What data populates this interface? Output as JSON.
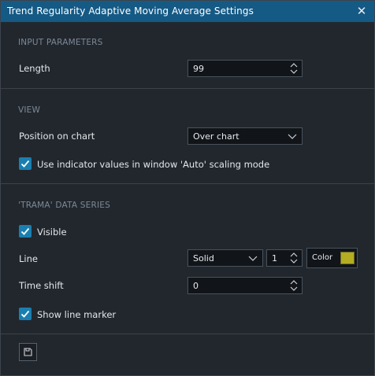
{
  "window": {
    "title": "Trend Regularity Adaptive Moving Average Settings"
  },
  "sections": {
    "input": {
      "title": "INPUT PARAMETERS",
      "length_label": "Length",
      "length_value": "99"
    },
    "view": {
      "title": "VIEW",
      "position_label": "Position on chart",
      "position_value": "Over chart",
      "auto_scaling_label": "Use indicator values in window 'Auto' scaling mode",
      "auto_scaling_checked": true
    },
    "series": {
      "title": "'TRAMA' DATA SERIES",
      "visible_label": "Visible",
      "visible_checked": true,
      "line_label": "Line",
      "line_style": "Solid",
      "line_width": "1",
      "color_label": "Color",
      "line_color": "#b4ac21",
      "time_shift_label": "Time shift",
      "time_shift_value": "0",
      "marker_label": "Show line marker",
      "marker_checked": true
    }
  },
  "icons": {
    "close": "close-icon",
    "save": "save-icon",
    "spin": "spinner-arrows-icon",
    "dropdown": "chevron-down-icon",
    "check": "checkmark-icon"
  },
  "colors": {
    "titlebar": "#155a85",
    "checkbox": "#1a7fb0",
    "background": "#22272e"
  }
}
